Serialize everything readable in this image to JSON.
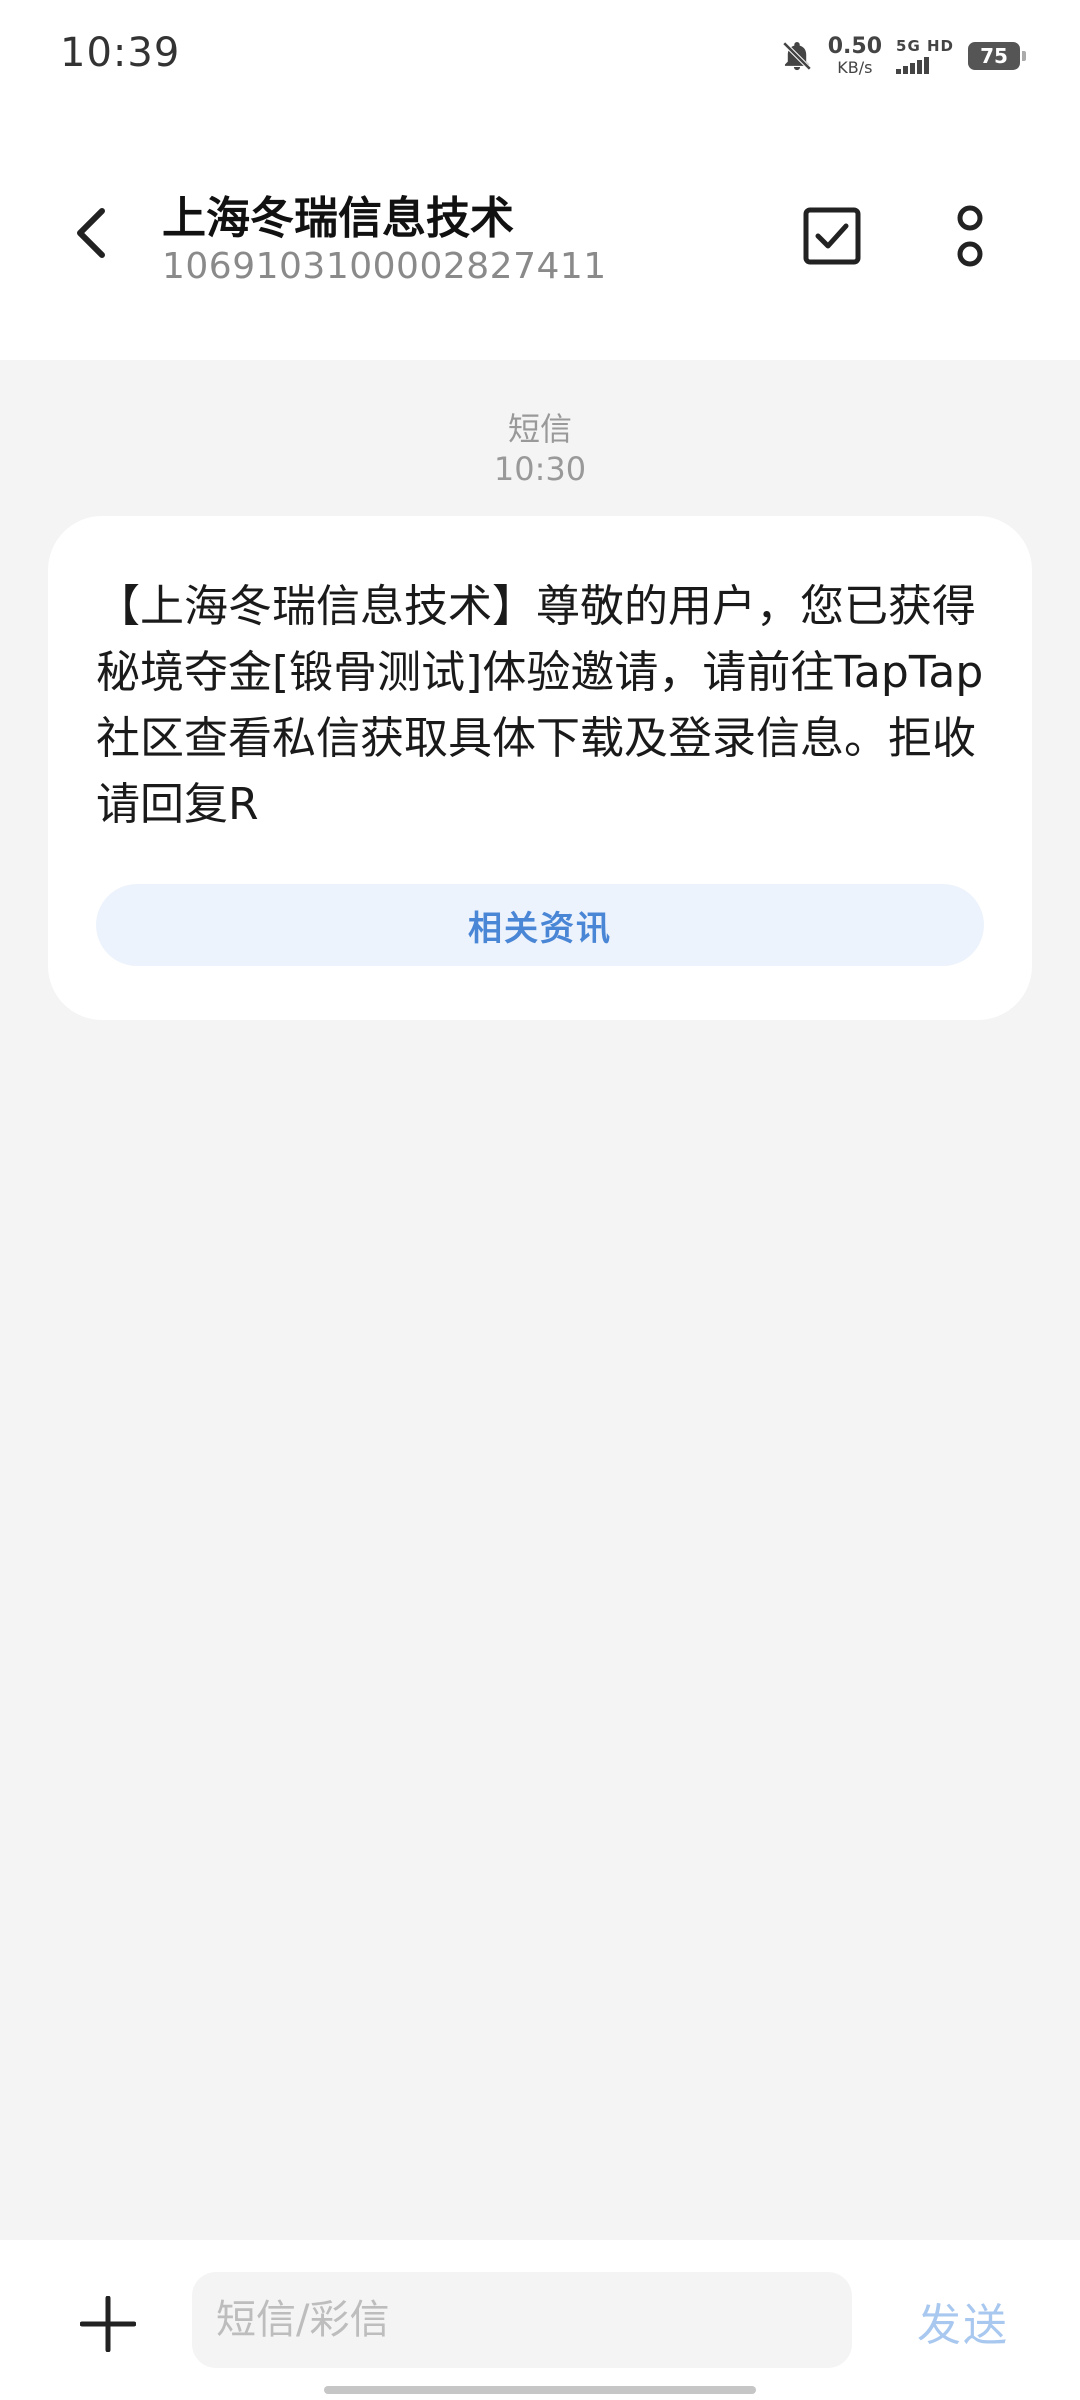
{
  "status_bar": {
    "time": "10:39",
    "net_speed_value": "0.50",
    "net_speed_unit": "KB/s",
    "network_label": "5G HD",
    "battery": "75",
    "mute_icon": "bell-off-icon"
  },
  "header": {
    "sender_name": "上海冬瑞信息技术",
    "sender_number": "1069103100002827411",
    "back_icon": "chevron-left-icon",
    "select_icon": "checkbox-icon",
    "more_icon": "more-vertical-icon"
  },
  "conversation": {
    "message_type": "短信",
    "message_time": "10:30",
    "message_text": "【上海冬瑞信息技术】尊敬的用户，您已获得秘境夺金[锻骨测试]体验邀请，请前往TapTap社区查看私信获取具体下载及登录信息。拒收请回复R",
    "related_button_label": "相关资讯"
  },
  "input_bar": {
    "placeholder": "短信/彩信",
    "send_label": "发送",
    "add_icon": "plus-icon"
  },
  "colors": {
    "background": "#f4f4f4",
    "accent": "#4a86d6",
    "send_disabled": "#a9c8ef"
  }
}
